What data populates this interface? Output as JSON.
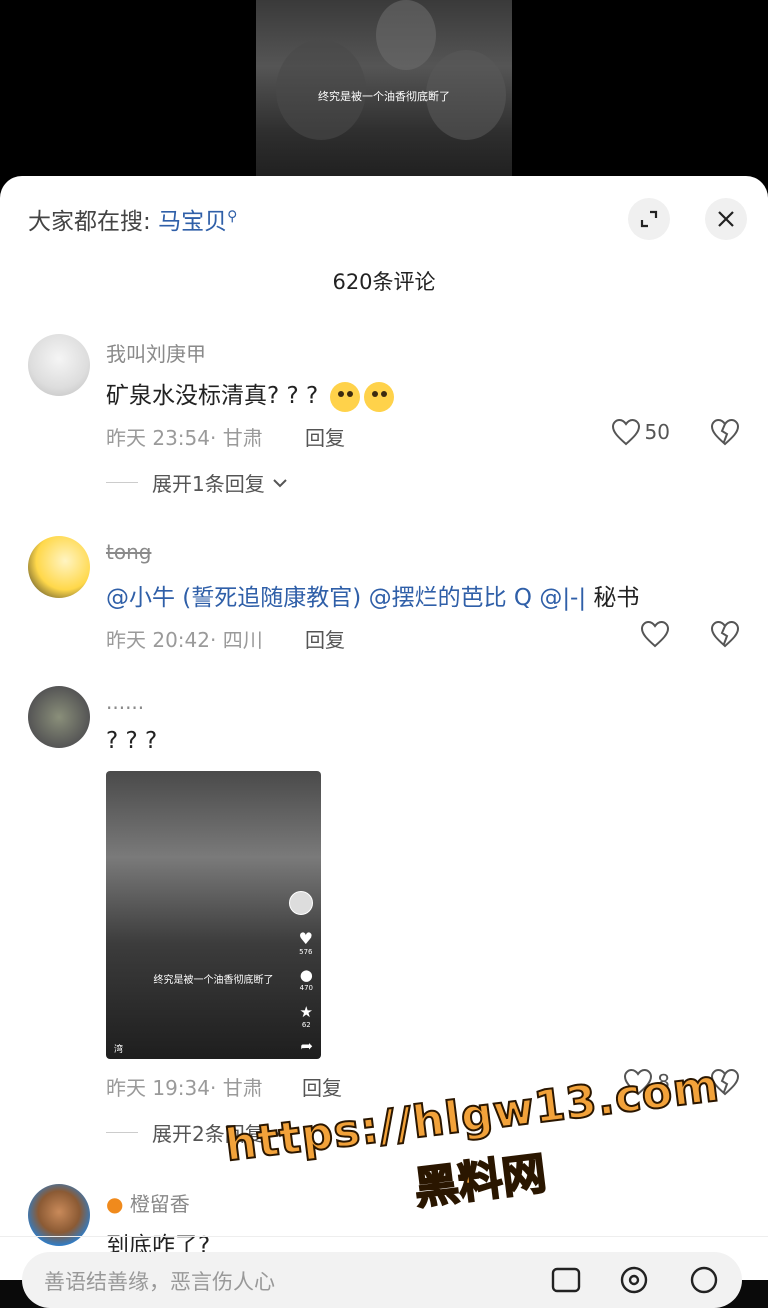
{
  "video": {
    "caption": "终究是被一个油香彻底断了"
  },
  "header": {
    "search_prefix": "大家都在搜: ",
    "search_term": "马宝贝",
    "comment_count": "620条评论"
  },
  "comments": [
    {
      "username": "我叫刘庚甲",
      "text": "矿泉水没标清真? ? ? ",
      "time_location": "昨天 23:54· 甘肃",
      "reply": "回复",
      "likes": "50",
      "expand": "展开1条回复"
    },
    {
      "username": "tong",
      "mentions": [
        "@小牛 (誓死追随康教官)",
        "@摆烂的芭比 Q",
        "@|-|"
      ],
      "text_tail": " 秘书",
      "time_location": "昨天 20:42· 四川",
      "reply": "回复"
    },
    {
      "username": "......",
      "text": "? ? ?",
      "thumb_caption": "终究是被一个油香彻底断了",
      "thumb_likes": "576",
      "thumb_comments": "470",
      "thumb_stars": "62",
      "thumb_corner": "湾",
      "time_location": "昨天 19:34· 甘肃",
      "reply": "回复",
      "likes": "8",
      "expand": "展开2条回复"
    },
    {
      "username": "橙留香",
      "text": "到底咋了?"
    }
  ],
  "watermark": {
    "url": "https://hlgw13.com",
    "name": "黑料网"
  },
  "input": {
    "placeholder": "善语结善缘，恶言伤人心"
  },
  "colors": {
    "accent": "#2f5fa8",
    "watermark": "#f2a23a"
  }
}
